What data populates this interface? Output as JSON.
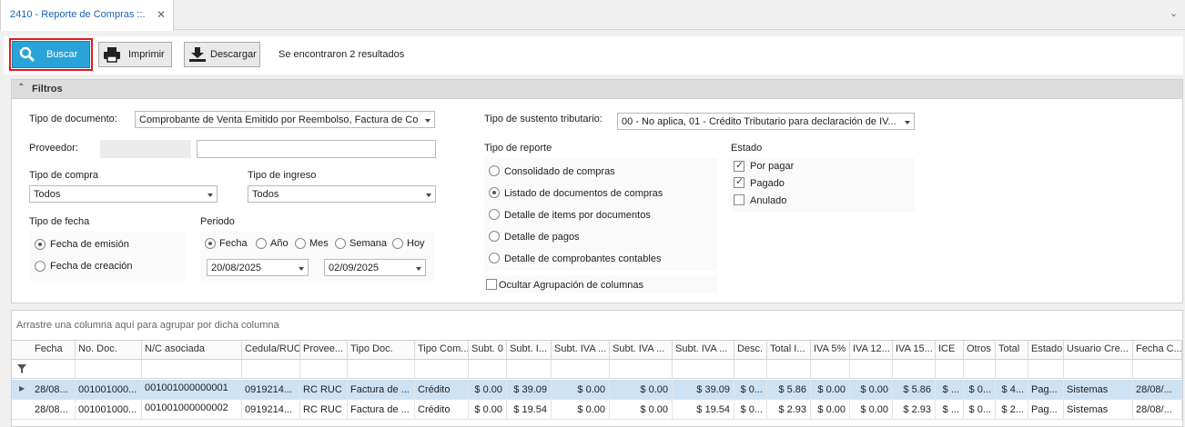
{
  "tab": {
    "title": "2410 - Reporte de Compras ::.",
    "close": "✕",
    "chevron": "⌄"
  },
  "toolbar": {
    "buscar": "Buscar",
    "imprimir": "Imprimir",
    "descargar": "Descargar",
    "results": "Se encontraron 2 resultados"
  },
  "filters": {
    "title": "Filtros",
    "tipo_documento_label": "Tipo de documento:",
    "tipo_documento_value": "Comprobante de Venta Emitido por Reembolso, Factura de Co...",
    "proveedor_label": "Proveedor:",
    "tipo_compra_label": "Tipo de compra",
    "tipo_compra_value": "Todos",
    "tipo_ingreso_label": "Tipo de ingreso",
    "tipo_ingreso_value": "Todos",
    "tipo_fecha_label": "Tipo de fecha",
    "fecha_emision": "Fecha de emisión",
    "fecha_creacion": "Fecha de creación",
    "periodo_label": "Periodo",
    "periodo_options": [
      "Fecha",
      "Año",
      "Mes",
      "Semana",
      "Hoy"
    ],
    "fecha_desde": "20/08/2025",
    "fecha_hasta": "02/09/2025",
    "sustento_label": "Tipo de sustento tributario:",
    "sustento_value": "00 - No aplica, 01 - Crédito Tributario para declaración de IV...",
    "tipo_reporte_label": "Tipo de reporte",
    "tipo_reporte_options": [
      "Consolidado de compras",
      "Listado de documentos de compras",
      "Detalle de items por documentos",
      "Detalle de pagos",
      "Detalle de comprobantes contables"
    ],
    "ocultar_agrupacion": "Ocultar Agrupación de columnas",
    "estado_label": "Estado",
    "estado_options": [
      "Por pagar",
      "Pagado",
      "Anulado"
    ]
  },
  "grid": {
    "group_hint": "Arrastre una columna aquí para agrupar por dicha columna",
    "columns": [
      "Fecha",
      "No. Doc.",
      "N/C asociada",
      "Cedula/RUC",
      "Provee...",
      "Tipo Doc.",
      "Tipo Com...",
      "Subt. 0",
      "Subt. I...",
      "Subt. IVA ...",
      "Subt. IVA ...",
      "Subt. IVA ...",
      "Desc.",
      "Total I...",
      "IVA 5%",
      "IVA 12...",
      "IVA 15...",
      "ICE",
      "Otros",
      "Total",
      "Estado",
      "Usuario Cre...",
      "Fecha C..."
    ],
    "rows": [
      [
        "28/08...",
        "001001000...",
        "001001000000001",
        "0919214...",
        "RC RUC",
        "Factura de ...",
        "Crédito",
        "$ 0.00",
        "$ 39.09",
        "$ 0.00",
        "$ 0.00",
        "$ 39.09",
        "$ 0...",
        "$ 5.86",
        "$ 0.00",
        "$ 0.00",
        "$ 5.86",
        "$ ...",
        "$ 0...",
        "$ 4...",
        "Pag...",
        "Sistemas",
        "28/08/..."
      ],
      [
        "28/08...",
        "001001000...",
        "001001000000002",
        "0919214...",
        "RC RUC",
        "Factura de ...",
        "Crédito",
        "$ 0.00",
        "$ 19.54",
        "$ 0.00",
        "$ 0.00",
        "$ 19.54",
        "$ 0...",
        "$ 2.93",
        "$ 0.00",
        "$ 0.00",
        "$ 2.93",
        "$ ...",
        "$ 0...",
        "$ 2...",
        "Pag...",
        "Sistemas",
        "28/08/..."
      ]
    ]
  }
}
